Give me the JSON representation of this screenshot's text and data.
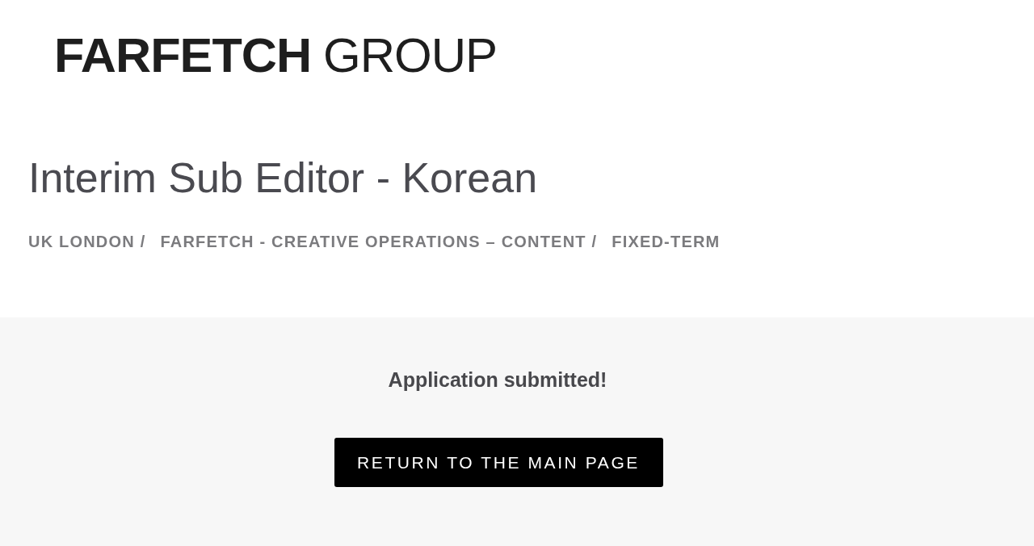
{
  "logo": {
    "brand": "FARFETCH",
    "suffix": "GROUP"
  },
  "job": {
    "title": "Interim Sub Editor - Korean",
    "meta": [
      "UK LONDON /",
      "FARFETCH - CREATIVE OPERATIONS – CONTENT /",
      "FIXED-TERM"
    ]
  },
  "confirmation": {
    "message": "Application submitted!",
    "button": "RETURN TO THE MAIN PAGE"
  }
}
